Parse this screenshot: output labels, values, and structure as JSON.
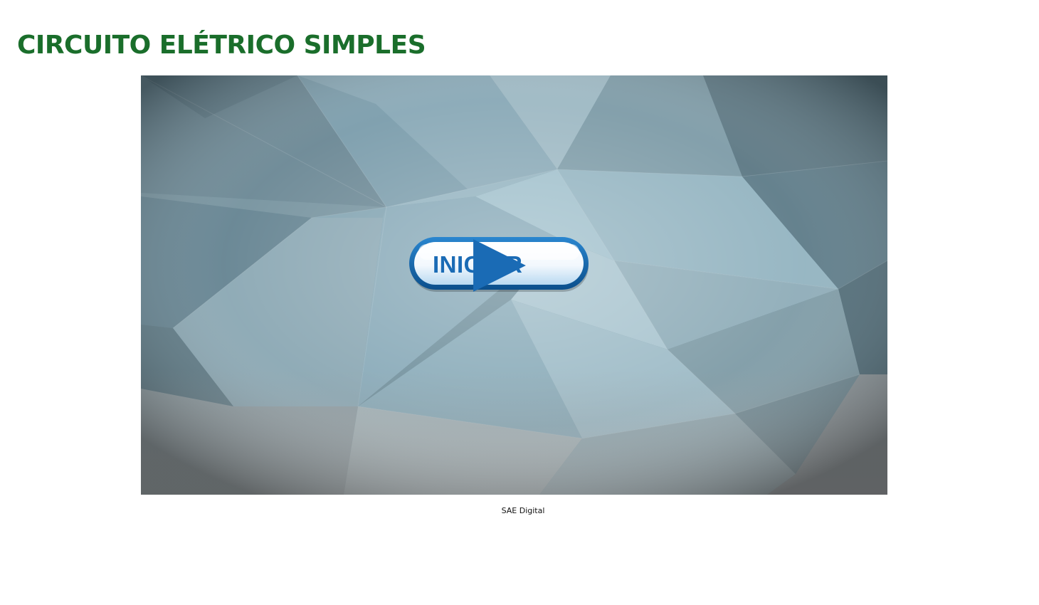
{
  "page": {
    "title": "CIRCUITO ELÉTRICO SIMPLES",
    "title_color": "#1a6e2b"
  },
  "stage": {
    "background": "low-poly-blue-grey",
    "start_button": {
      "label": "INICIAR",
      "icon": "play-icon",
      "text_color": "#1a6bb5"
    }
  },
  "footer": {
    "credit": "SAE Digital"
  }
}
